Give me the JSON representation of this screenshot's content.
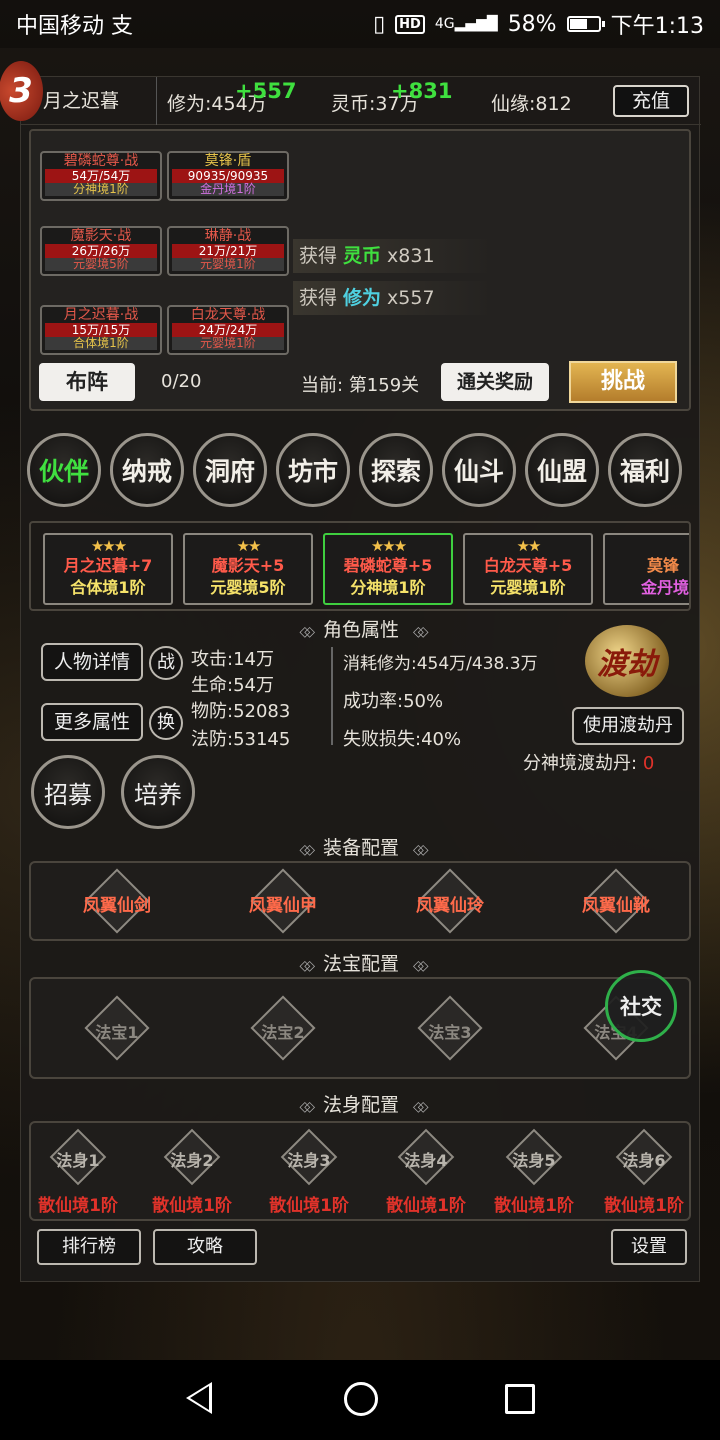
{
  "status_bar": {
    "carrier": "中国移动",
    "carrier_extra": "支",
    "hd": "HD",
    "signal": "4G",
    "battery": "58%",
    "battery_level": 0.58,
    "time": "下午1:13"
  },
  "header": {
    "badge": "3",
    "player_name": "月之迟暮",
    "cultivation": "修为:454万",
    "cultivation_gain": "+557",
    "spirit_coin": "灵币:37万",
    "spirit_coin_gain": "+831",
    "xian_yuan": "仙缘:812",
    "recharge": "充值"
  },
  "battle": {
    "units": [
      {
        "name": "碧磷蛇尊·战",
        "hp": "54万/54万",
        "realm": "分神境1阶",
        "name_color": "#e4584a",
        "realm_color": "#e6c34a"
      },
      {
        "name": "莫锋·盾",
        "hp": "90935/90935",
        "realm": "金丹境1阶",
        "name_color": "#e6c34a",
        "realm_color": "#d070e0"
      },
      {
        "name": "魔影天·战",
        "hp": "26万/26万",
        "realm": "元婴境5阶",
        "name_color": "#e4584a",
        "realm_color": "#e4584a"
      },
      {
        "name": "琳静·战",
        "hp": "21万/21万",
        "realm": "元婴境1阶",
        "name_color": "#e4584a",
        "realm_color": "#e4584a"
      },
      {
        "name": "月之迟暮·战",
        "hp": "15万/15万",
        "realm": "合体境1阶",
        "name_color": "#e4584a",
        "realm_color": "#e6c34a"
      },
      {
        "name": "白龙天尊·战",
        "hp": "24万/24万",
        "realm": "元婴境1阶",
        "name_color": "#e4584a",
        "realm_color": "#e4584a"
      }
    ],
    "loot": [
      {
        "prefix": "获得",
        "item": "灵币",
        "amount": "x831",
        "color": "#3fe03f"
      },
      {
        "prefix": "获得",
        "item": "修为",
        "amount": "x557",
        "color": "#4fd0e0"
      }
    ],
    "formation": "布阵",
    "progress": "0/20",
    "current_label": "当前:",
    "current_stage": "第159关",
    "clear_reward": "通关奖励",
    "challenge": "挑战"
  },
  "menu": [
    "伙伴",
    "纳戒",
    "洞府",
    "坊市",
    "探索",
    "仙斗",
    "仙盟",
    "福利"
  ],
  "partners": [
    {
      "stars": "★★★",
      "name": "月之迟暮+7",
      "realm": "合体境1阶",
      "selected": false
    },
    {
      "stars": "★★",
      "name": "魔影天+5",
      "realm": "元婴境5阶",
      "selected": false
    },
    {
      "stars": "★★★",
      "name": "碧磷蛇尊+5",
      "realm": "分神境1阶",
      "selected": true
    },
    {
      "stars": "★★",
      "name": "白龙天尊+5",
      "realm": "元婴境1阶",
      "selected": false
    },
    {
      "stars": "",
      "name": "莫锋",
      "realm": "金丹境",
      "selected": false
    }
  ],
  "attributes": {
    "title": "角色属性",
    "details_btn": "人物详情",
    "more_btn": "更多属性",
    "battle_btn": "战",
    "switch_btn": "换",
    "attack": "攻击:14万",
    "hp": "生命:54万",
    "phys_def": "物防:52083",
    "mag_def": "法防:53145",
    "consume": "消耗修为:454万/438.3万",
    "success": "成功率:50%",
    "fail_loss": "失败损失:40%",
    "dujie": "渡劫",
    "use_pill": "使用渡劫丹",
    "pill_label": "分神境渡劫丹:",
    "pill_count": "0",
    "recruit": "招募",
    "train": "培养"
  },
  "equipment": {
    "title": "装备配置",
    "items": [
      "凤翼仙剑",
      "凤翼仙甲",
      "凤翼仙玲",
      "凤翼仙靴"
    ]
  },
  "treasures": {
    "title": "法宝配置",
    "items": [
      "法宝1",
      "法宝2",
      "法宝3",
      "法宝4"
    ],
    "social": "社交"
  },
  "bodies": {
    "title": "法身配置",
    "items": [
      {
        "label": "法身1",
        "realm": "散仙境1阶"
      },
      {
        "label": "法身2",
        "realm": "散仙境1阶"
      },
      {
        "label": "法身3",
        "realm": "散仙境1阶"
      },
      {
        "label": "法身4",
        "realm": "散仙境1阶"
      },
      {
        "label": "法身5",
        "realm": "散仙境1阶"
      },
      {
        "label": "法身6",
        "realm": "散仙境1阶"
      }
    ]
  },
  "bottom": {
    "ranking": "排行榜",
    "guide": "攻略",
    "settings": "设置"
  }
}
